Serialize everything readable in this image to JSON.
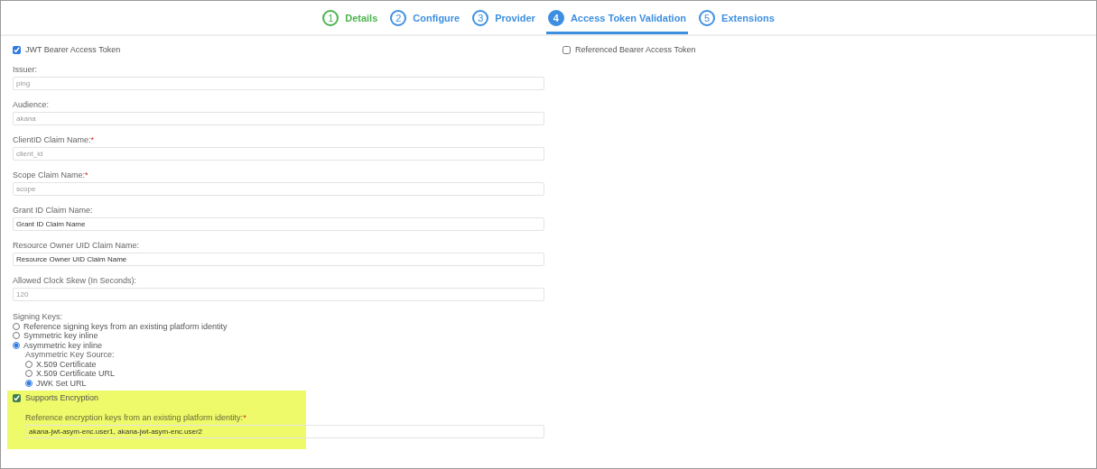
{
  "steps": [
    {
      "number": "1",
      "label": "Details",
      "completed": true,
      "selected": false
    },
    {
      "number": "2",
      "label": "Configure",
      "completed": false,
      "selected": false
    },
    {
      "number": "3",
      "label": "Provider",
      "completed": false,
      "selected": false
    },
    {
      "number": "4",
      "label": "Access Token Validation",
      "completed": false,
      "selected": true
    },
    {
      "number": "5",
      "label": "Extensions",
      "completed": false,
      "selected": false
    }
  ],
  "jwt_bearer": {
    "label": "JWT Bearer Access Token",
    "checked": true
  },
  "referenced_bearer": {
    "label": "Referenced Bearer Access Token",
    "checked": false
  },
  "fields": [
    {
      "label": "Issuer:",
      "placeholder": "ping"
    },
    {
      "label": "Audience:",
      "placeholder": "akana"
    },
    {
      "label": "ClientID Claim Name:",
      "required_mark": "*",
      "placeholder": "client_id"
    },
    {
      "label": "Scope Claim Name:",
      "required_mark": "*",
      "placeholder": "scope"
    },
    {
      "label": "Grant ID Claim Name:",
      "value": "Grant ID Claim Name"
    },
    {
      "label": "Resource Owner UID Claim Name:",
      "value": "Resource Owner UID Claim Name"
    },
    {
      "label": "Allowed Clock Skew (In Seconds):",
      "placeholder": "120"
    }
  ],
  "signing_keys": {
    "label": "Signing Keys:",
    "options": [
      {
        "label": "Reference signing keys from an existing platform identity",
        "selected": false
      },
      {
        "label": "Symmetric key inline",
        "selected": false
      },
      {
        "label": "Asymmetric key inline",
        "selected": true
      }
    ]
  },
  "key_source": {
    "label": "Asymmetric Key Source:",
    "options": [
      {
        "label": "X.509 Certificate",
        "selected": false
      },
      {
        "label": "X.509 Certificate URL",
        "selected": false
      },
      {
        "label": "JWK Set URL",
        "selected": true
      }
    ]
  },
  "encryption": {
    "label": "Supports Encryption",
    "checked": true,
    "highlighted": true,
    "field": {
      "label": "Reference encryption keys from an existing platform identity:",
      "required_mark": "*",
      "value": "akana-jwt-asym-enc.user1, akana-jwt-asym-enc.user2"
    }
  }
}
